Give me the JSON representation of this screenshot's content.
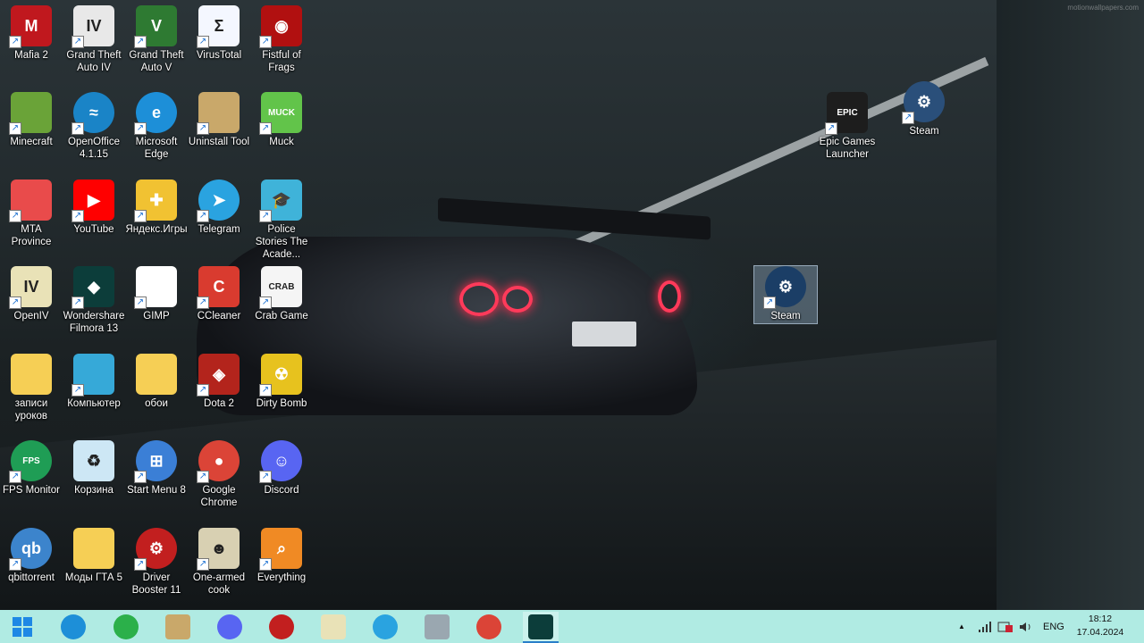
{
  "desktop": {
    "watermark": "motionwallpapers.com",
    "icons": [
      {
        "label": "Mafia 2",
        "color": "#c0181e",
        "glyph": "M"
      },
      {
        "label": "Grand Theft Auto IV",
        "color": "#e8e8e8",
        "glyph": "IV"
      },
      {
        "label": "Grand Theft Auto V",
        "color": "#2e7a32",
        "glyph": "V"
      },
      {
        "label": "VirusTotal",
        "color": "#f4f7ff",
        "glyph": "Σ"
      },
      {
        "label": "Fistful of Frags",
        "color": "#b11010",
        "glyph": "◉"
      },
      {
        "label": "Minecraft",
        "color": "#6aa338",
        "glyph": ""
      },
      {
        "label": "OpenOffice 4.1.15",
        "color": "#1a84c7",
        "glyph": "≈"
      },
      {
        "label": "Microsoft Edge",
        "color": "#1d8fd8",
        "glyph": "e"
      },
      {
        "label": "Uninstall Tool",
        "color": "#c9a86a",
        "glyph": ""
      },
      {
        "label": "Muck",
        "color": "#62c44a",
        "glyph": "MUCK"
      },
      {
        "label": "MTA Province",
        "color": "#e94b4b",
        "glyph": ""
      },
      {
        "label": "YouTube",
        "color": "#ff0000",
        "glyph": "▶"
      },
      {
        "label": "Яндекс.Игры",
        "color": "#f1c232",
        "glyph": "✚"
      },
      {
        "label": "Telegram",
        "color": "#2aa3e0",
        "glyph": "➤"
      },
      {
        "label": "Police Stories The Acade...",
        "color": "#3fb3d9",
        "glyph": "🎓"
      },
      {
        "label": "OpenIV",
        "color": "#e9e2b7",
        "glyph": "IV"
      },
      {
        "label": "Wondershare Filmora 13",
        "color": "#0c3d3a",
        "glyph": "◆"
      },
      {
        "label": "GIMP",
        "color": "#ffffff",
        "glyph": ""
      },
      {
        "label": "CCleaner",
        "color": "#d93b2f",
        "glyph": "C"
      },
      {
        "label": "Crab Game",
        "color": "#f5f5f5",
        "glyph": "CRAB"
      },
      {
        "label": "записи уроков",
        "color": "#f6cf55",
        "glyph": ""
      },
      {
        "label": "Компьютер",
        "color": "#36a9d8",
        "glyph": ""
      },
      {
        "label": "обои",
        "color": "#f6cf55",
        "glyph": ""
      },
      {
        "label": "Dota 2",
        "color": "#b3241c",
        "glyph": "◈"
      },
      {
        "label": "Dirty Bomb",
        "color": "#e7c21e",
        "glyph": "☢"
      },
      {
        "label": "FPS Monitor",
        "color": "#1f9d55",
        "glyph": "FPS"
      },
      {
        "label": "Корзина",
        "color": "#cde7f5",
        "glyph": "♻"
      },
      {
        "label": "Start Menu 8",
        "color": "#3b7fd6",
        "glyph": "⊞"
      },
      {
        "label": "Google Chrome",
        "color": "#db4437",
        "glyph": "●"
      },
      {
        "label": "Discord",
        "color": "#5865f2",
        "glyph": "☺"
      },
      {
        "label": "qbittorrent",
        "color": "#3c84cc",
        "glyph": "qb"
      },
      {
        "label": "Моды ГТА 5",
        "color": "#f6cf55",
        "glyph": ""
      },
      {
        "label": "Driver Booster 11",
        "color": "#c21f1f",
        "glyph": "⚙"
      },
      {
        "label": "One-armed cook",
        "color": "#d8d0b2",
        "glyph": "☻"
      },
      {
        "label": "Everything",
        "color": "#f08a24",
        "glyph": "⌕"
      },
      {
        "label": "Epic Games Launcher",
        "color": "#1d1d1d",
        "glyph": "EPIC"
      },
      {
        "label": "Steam",
        "color": "#2a4f7a",
        "glyph": "⚙"
      },
      {
        "label": "Steam",
        "color": "#1b3e66",
        "glyph": "⚙"
      }
    ]
  },
  "taskbar": {
    "apps": [
      {
        "name": "windows-start-button",
        "color": "#1e88e5"
      },
      {
        "name": "edge-taskbar",
        "color": "#1d8fd8"
      },
      {
        "name": "fps-monitor-taskbar",
        "color": "#2bb04a"
      },
      {
        "name": "uninstall-tool-taskbar",
        "color": "#c9a86a"
      },
      {
        "name": "discord-taskbar",
        "color": "#5865f2"
      },
      {
        "name": "driver-booster-taskbar",
        "color": "#c21f1f"
      },
      {
        "name": "openiv-taskbar",
        "color": "#e9e2b7"
      },
      {
        "name": "telegram-taskbar",
        "color": "#2aa3e0"
      },
      {
        "name": "image-viewer-taskbar",
        "color": "#9aa7b0"
      },
      {
        "name": "chrome-taskbar",
        "color": "#db4437"
      },
      {
        "name": "filmora-taskbar",
        "color": "#0c3d3a"
      }
    ],
    "language": "ENG",
    "time": "18:12",
    "date": "17.04.2024",
    "tray_up_arrow": "▲"
  }
}
